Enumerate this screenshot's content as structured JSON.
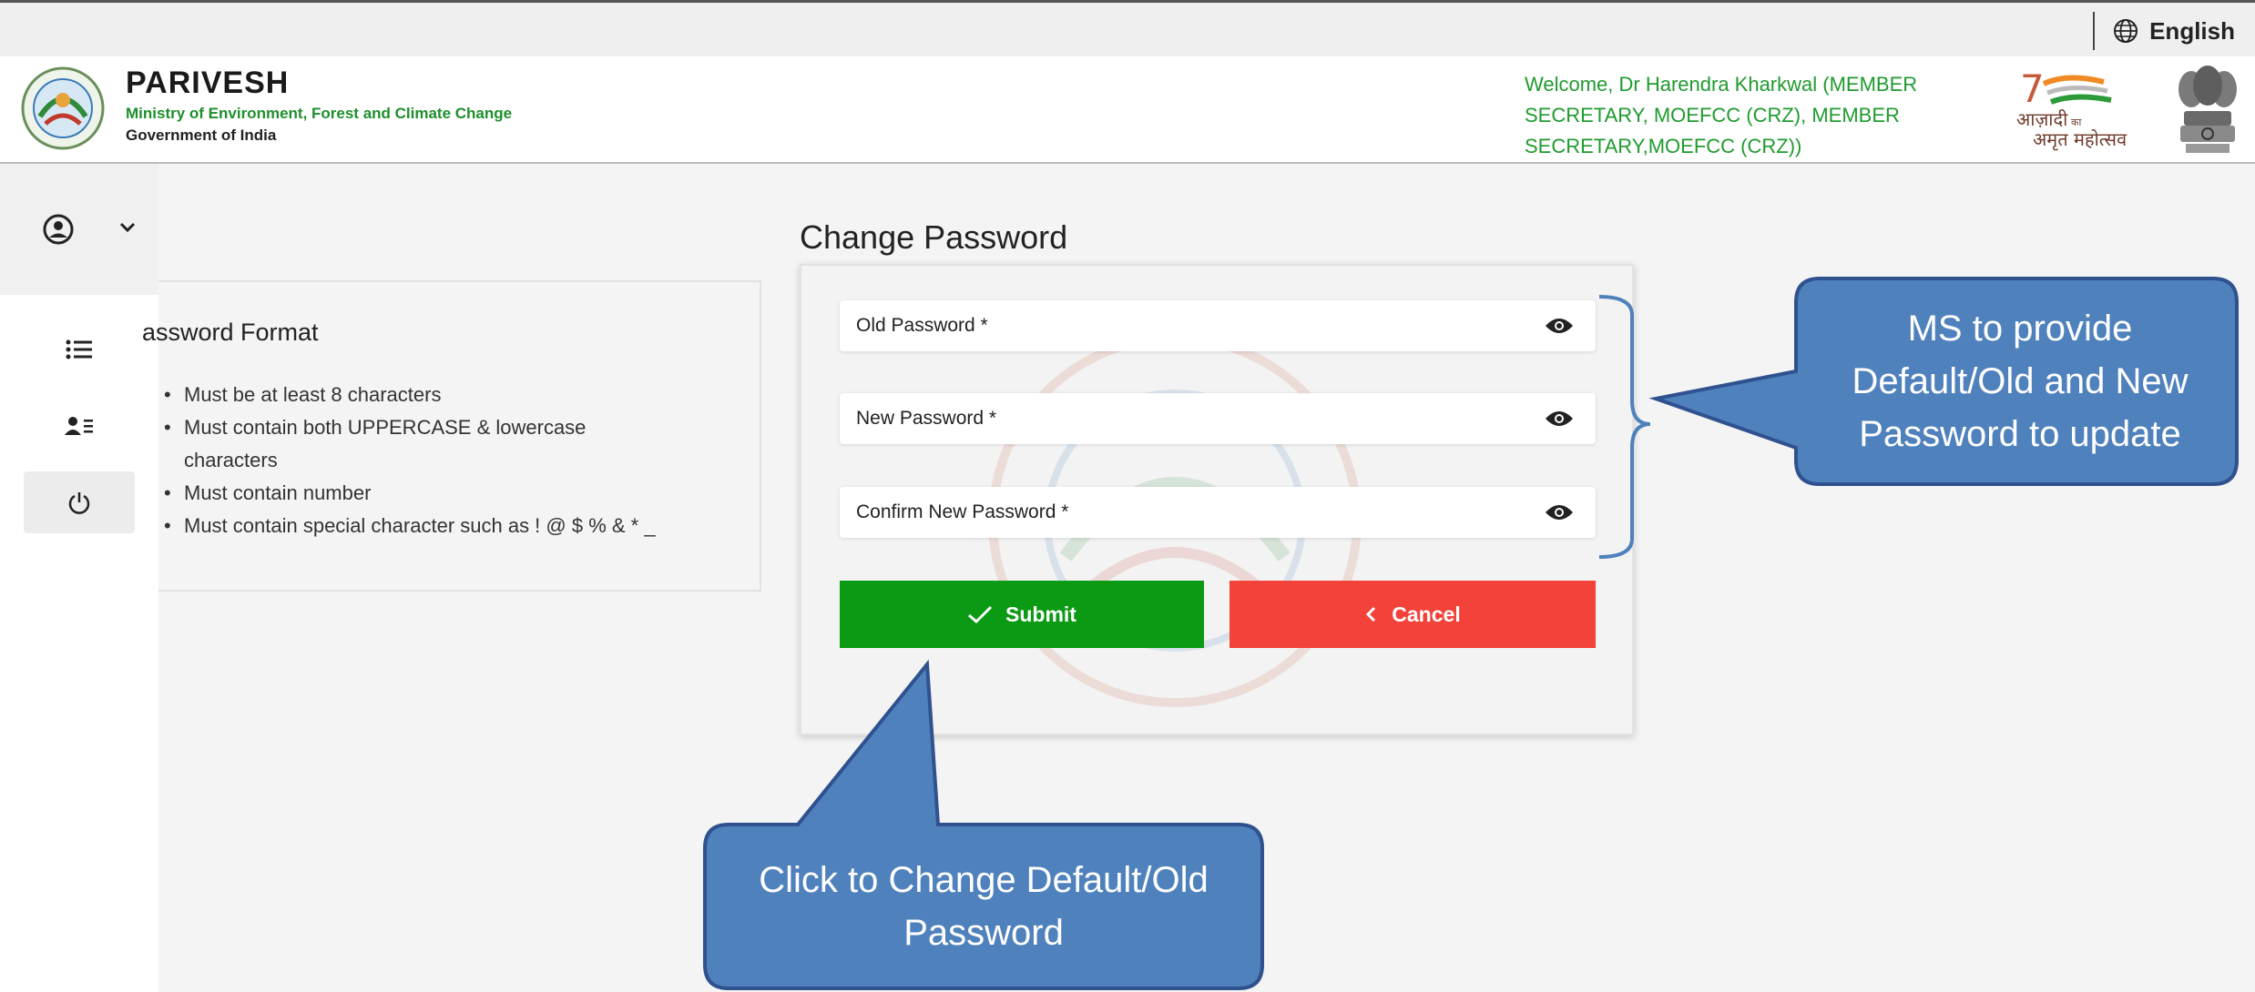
{
  "topbar": {
    "language_label": "English"
  },
  "header": {
    "brand_title": "PARIVESH",
    "brand_subtitle": "Ministry of Environment, Forest and Climate Change",
    "brand_gov": "Government of India",
    "welcome_lines": [
      "Welcome, Dr Harendra Kharkwal (MEMBER",
      "SECRETARY, MOEFCC (CRZ), MEMBER",
      "SECRETARY,MOEFCC (CRZ))"
    ],
    "azadi_line1": "आज़ादी",
    "azadi_small": "का",
    "azadi_line2": "अमृत महोत्सव"
  },
  "password_format": {
    "title": "assword Format",
    "rules": [
      "Must be at least 8 characters",
      "Must contain both UPPERCASE & lowercase",
      "characters",
      "Must contain number",
      "Must contain special character such as ! @ $ % & * _"
    ]
  },
  "change_password": {
    "title": "Change Password",
    "old_password_label": "Old Password *",
    "new_password_label": "New Password *",
    "confirm_password_label": "Confirm New Password *",
    "submit_label": "Submit",
    "cancel_label": "Cancel"
  },
  "callouts": {
    "right_lines": [
      "MS to provide",
      "Default/Old and New",
      "Password to update"
    ],
    "bottom_lines": [
      "Click to Change Default/Old",
      "Password"
    ]
  },
  "colors": {
    "brand_green": "#1e8f2c",
    "submit_green": "#0b9a13",
    "cancel_red": "#f2423a",
    "callout_blue": "#4f81bd",
    "callout_border": "#2f528f"
  }
}
